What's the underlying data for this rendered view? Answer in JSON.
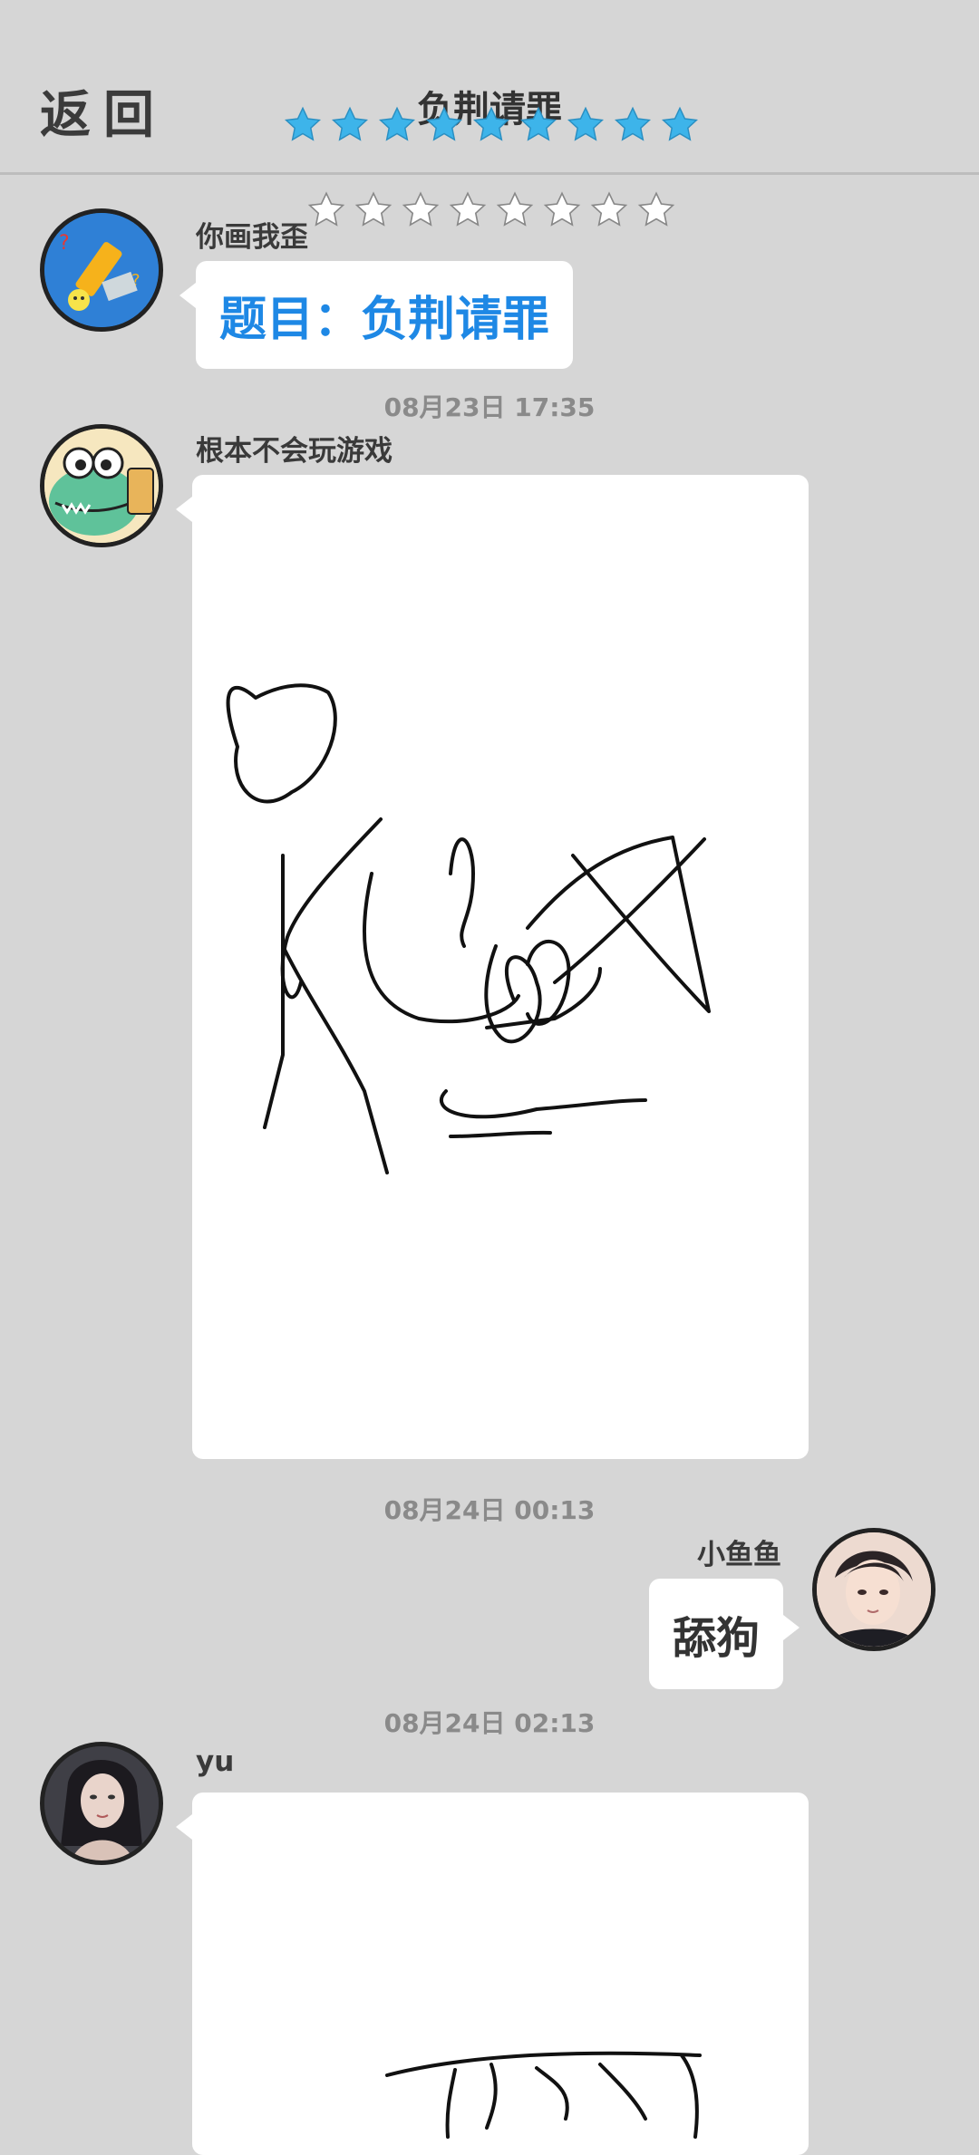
{
  "header": {
    "back_label": "返回",
    "title": "负荆请罪"
  },
  "ratings": {
    "top_row_filled": 9,
    "bottom_row_filled": 0,
    "star_color": "#3db4ea"
  },
  "messages": [
    {
      "sender": "你画我歪",
      "text": "题目：负荆请罪"
    },
    {
      "timestamp": "08月23日  17:35",
      "sender": "根本不会玩游戏"
    },
    {
      "timestamp": "08月24日  00:13",
      "sender": "小鱼鱼",
      "text": "舔狗"
    },
    {
      "timestamp": "08月24日  02:13",
      "sender": "yu"
    }
  ]
}
